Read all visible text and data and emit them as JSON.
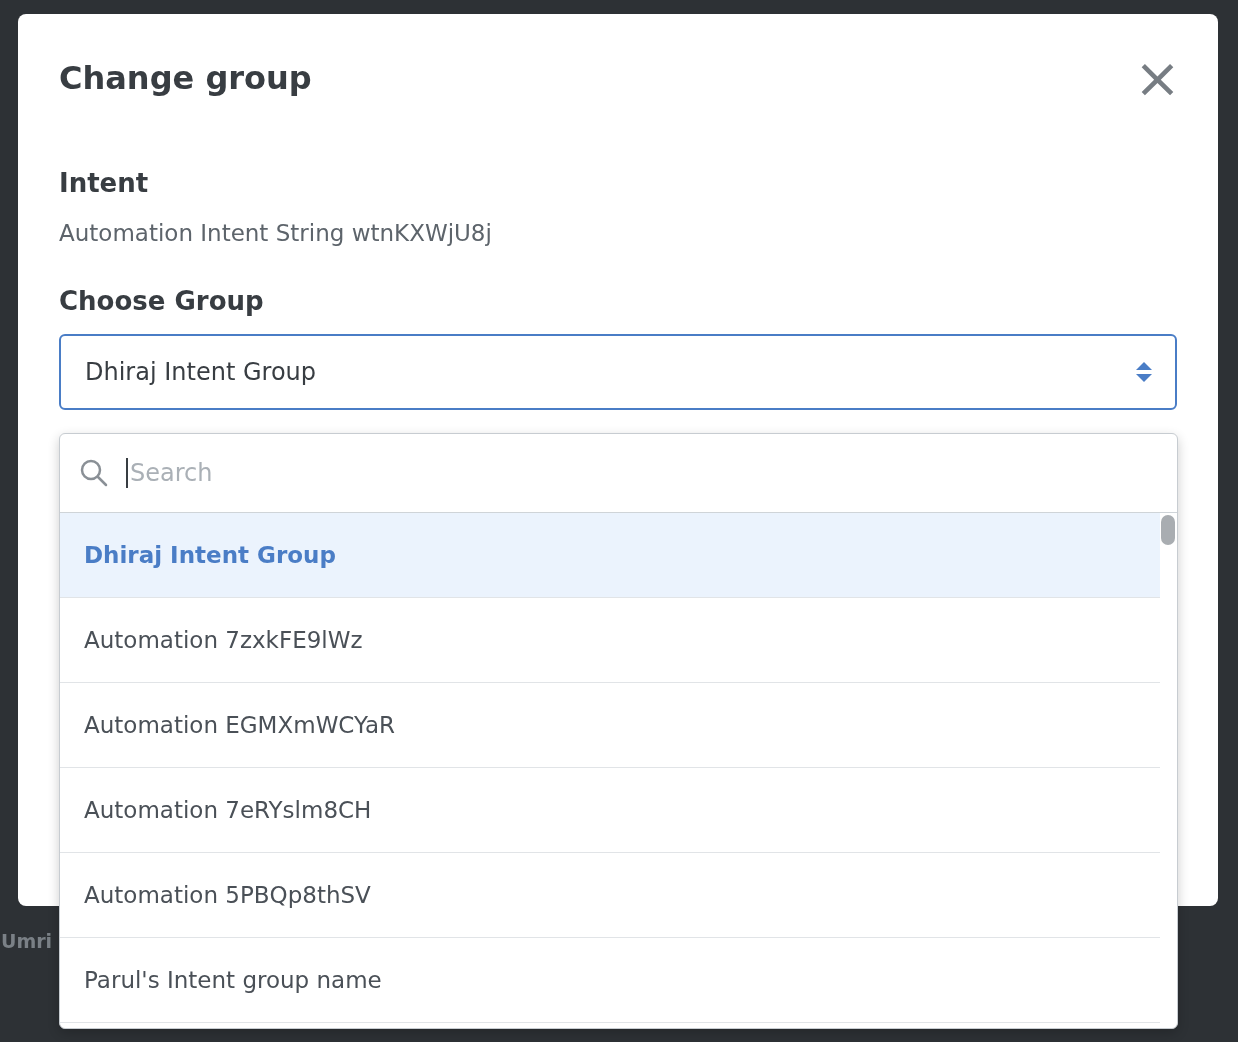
{
  "background": {
    "user_fragment": "Umri"
  },
  "dialog": {
    "title": "Change group",
    "close": "×",
    "intent": {
      "label": "Intent",
      "value": "Automation Intent String wtnKXWjU8j"
    },
    "group": {
      "label": "Choose Group",
      "value": "Dhiraj Intent Group",
      "expanded": true
    },
    "dropdown": {
      "search": {
        "placeholder": "Search"
      },
      "options": [
        {
          "label": "Dhiraj Intent Group",
          "selected": true
        },
        {
          "label": "Automation 7zxkFE9lWz",
          "selected": false
        },
        {
          "label": "Automation EGMXmWCYaR",
          "selected": false
        },
        {
          "label": "Automation 7eRYslm8CH",
          "selected": false
        },
        {
          "label": "Automation 5PBQp8thSV",
          "selected": false
        },
        {
          "label": "Parul's Intent group name",
          "selected": false
        }
      ]
    }
  }
}
